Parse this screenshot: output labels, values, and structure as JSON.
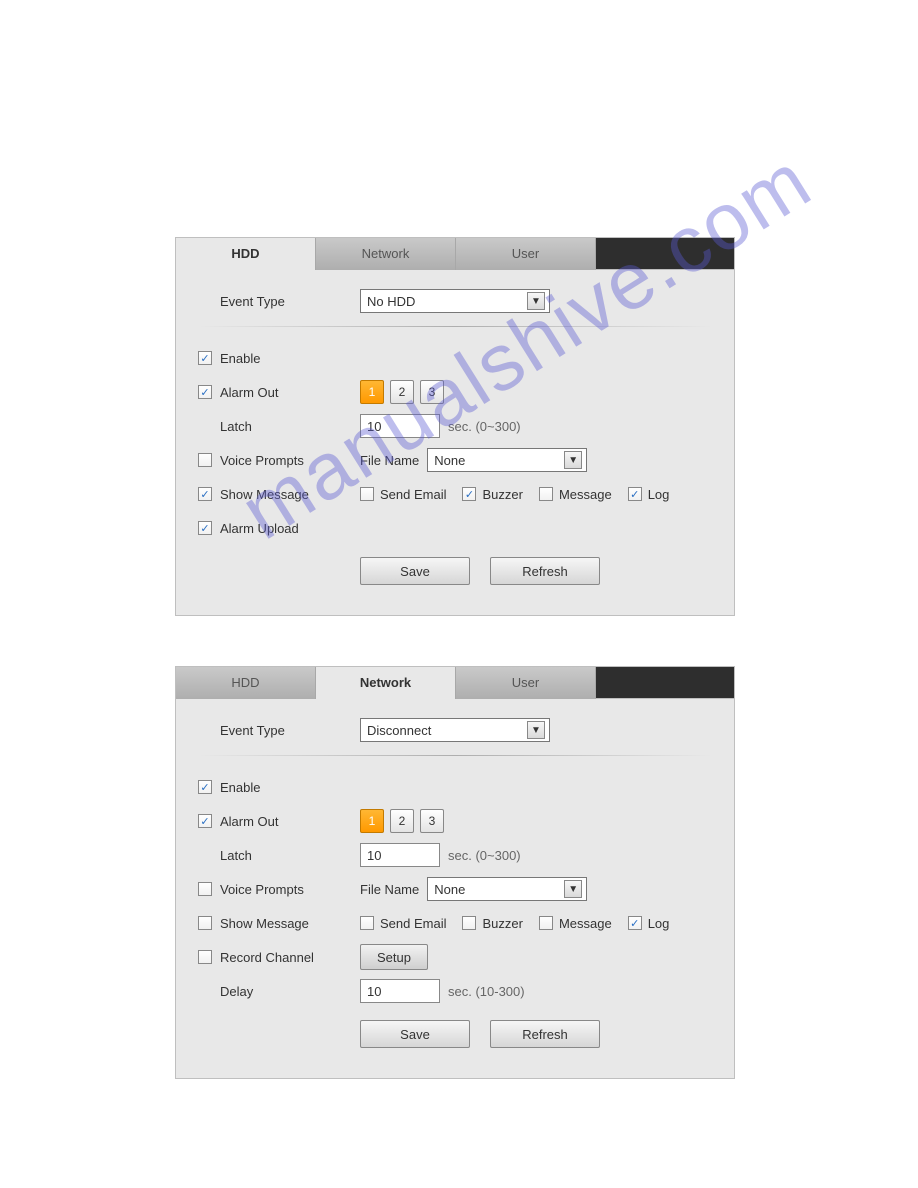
{
  "watermark_text": "manualshive.com",
  "panel1": {
    "tabs": {
      "hdd": "HDD",
      "network": "Network",
      "user": "User",
      "active": "hdd"
    },
    "eventTypeLabel": "Event Type",
    "eventTypeValue": "No HDD",
    "enableLabel": "Enable",
    "enableChecked": true,
    "alarmOutLabel": "Alarm Out",
    "alarmOutChecked": true,
    "alarmOutButtons": [
      "1",
      "2",
      "3"
    ],
    "alarmOutActiveIndex": 0,
    "latchLabel": "Latch",
    "latchValue": "10",
    "latchHint": "sec. (0~300)",
    "voicePromptsLabel": "Voice Prompts",
    "voicePromptsChecked": false,
    "fileNameLabel": "File Name",
    "fileNameValue": "None",
    "showMessageLabel": "Show Message",
    "showMessageChecked": true,
    "sendEmail": {
      "label": "Send Email",
      "checked": false
    },
    "buzzer": {
      "label": "Buzzer",
      "checked": true
    },
    "message": {
      "label": "Message",
      "checked": false
    },
    "log": {
      "label": "Log",
      "checked": true
    },
    "alarmUploadLabel": "Alarm Upload",
    "alarmUploadChecked": true,
    "saveLabel": "Save",
    "refreshLabel": "Refresh"
  },
  "panel2": {
    "tabs": {
      "hdd": "HDD",
      "network": "Network",
      "user": "User",
      "active": "network"
    },
    "eventTypeLabel": "Event Type",
    "eventTypeValue": "Disconnect",
    "enableLabel": "Enable",
    "enableChecked": true,
    "alarmOutLabel": "Alarm Out",
    "alarmOutChecked": true,
    "alarmOutButtons": [
      "1",
      "2",
      "3"
    ],
    "alarmOutActiveIndex": 0,
    "latchLabel": "Latch",
    "latchValue": "10",
    "latchHint": "sec. (0~300)",
    "voicePromptsLabel": "Voice Prompts",
    "voicePromptsChecked": false,
    "fileNameLabel": "File Name",
    "fileNameValue": "None",
    "showMessageLabel": "Show Message",
    "showMessageChecked": false,
    "sendEmail": {
      "label": "Send Email",
      "checked": false
    },
    "buzzer": {
      "label": "Buzzer",
      "checked": false
    },
    "message": {
      "label": "Message",
      "checked": false
    },
    "log": {
      "label": "Log",
      "checked": true
    },
    "recordChannelLabel": "Record Channel",
    "recordChannelChecked": false,
    "setupLabel": "Setup",
    "delayLabel": "Delay",
    "delayValue": "10",
    "delayHint": "sec. (10-300)",
    "saveLabel": "Save",
    "refreshLabel": "Refresh"
  }
}
